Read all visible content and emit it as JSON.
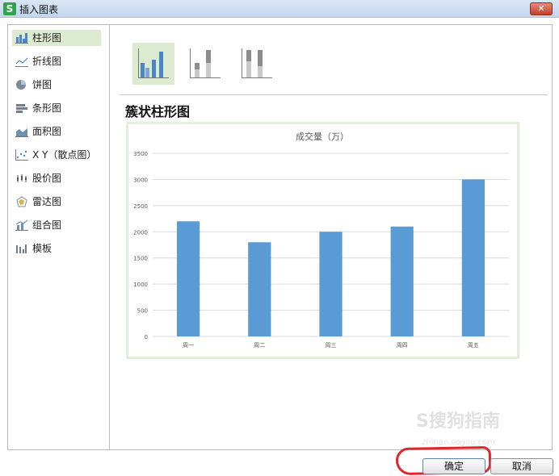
{
  "window": {
    "title": "插入图表",
    "app_icon_letter": "S",
    "close_symbol": "✕"
  },
  "sidebar": {
    "items": [
      {
        "label": "柱形图",
        "icon": "column-chart-icon",
        "active": true
      },
      {
        "label": "折线图",
        "icon": "line-chart-icon"
      },
      {
        "label": "饼图",
        "icon": "pie-chart-icon"
      },
      {
        "label": "条形图",
        "icon": "bar-chart-icon"
      },
      {
        "label": "面积图",
        "icon": "area-chart-icon"
      },
      {
        "label": "X Y（散点图）",
        "icon": "scatter-chart-icon"
      },
      {
        "label": "股价图",
        "icon": "stock-chart-icon"
      },
      {
        "label": "雷达图",
        "icon": "radar-chart-icon"
      },
      {
        "label": "组合图",
        "icon": "combo-chart-icon"
      },
      {
        "label": "模板",
        "icon": "template-icon"
      }
    ]
  },
  "subtypes": [
    {
      "icon": "clustered-column-icon",
      "active": true
    },
    {
      "icon": "stacked-column-icon"
    },
    {
      "icon": "percent-stacked-column-icon"
    }
  ],
  "preview": {
    "subtype_title": "簇状柱形图"
  },
  "chart_data": {
    "type": "bar",
    "title": "成交量（万）",
    "categories": [
      "周一",
      "周二",
      "周三",
      "周四",
      "周五"
    ],
    "values": [
      2200,
      1800,
      2000,
      2100,
      3000
    ],
    "ylim": [
      0,
      3500
    ],
    "yticks": [
      0,
      500,
      1000,
      1500,
      2000,
      2500,
      3000,
      3500
    ],
    "grid": true,
    "bar_color": "#5b9bd5",
    "xlabel": "",
    "ylabel": ""
  },
  "buttons": {
    "ok_label": "确定",
    "cancel_label": "取消"
  },
  "watermark": {
    "text": "S搜狗指南",
    "sub": "zhinan.sogou.com"
  },
  "colors": {
    "active_bg": "#dcebd0",
    "highlight_ring": "#e0262b"
  }
}
